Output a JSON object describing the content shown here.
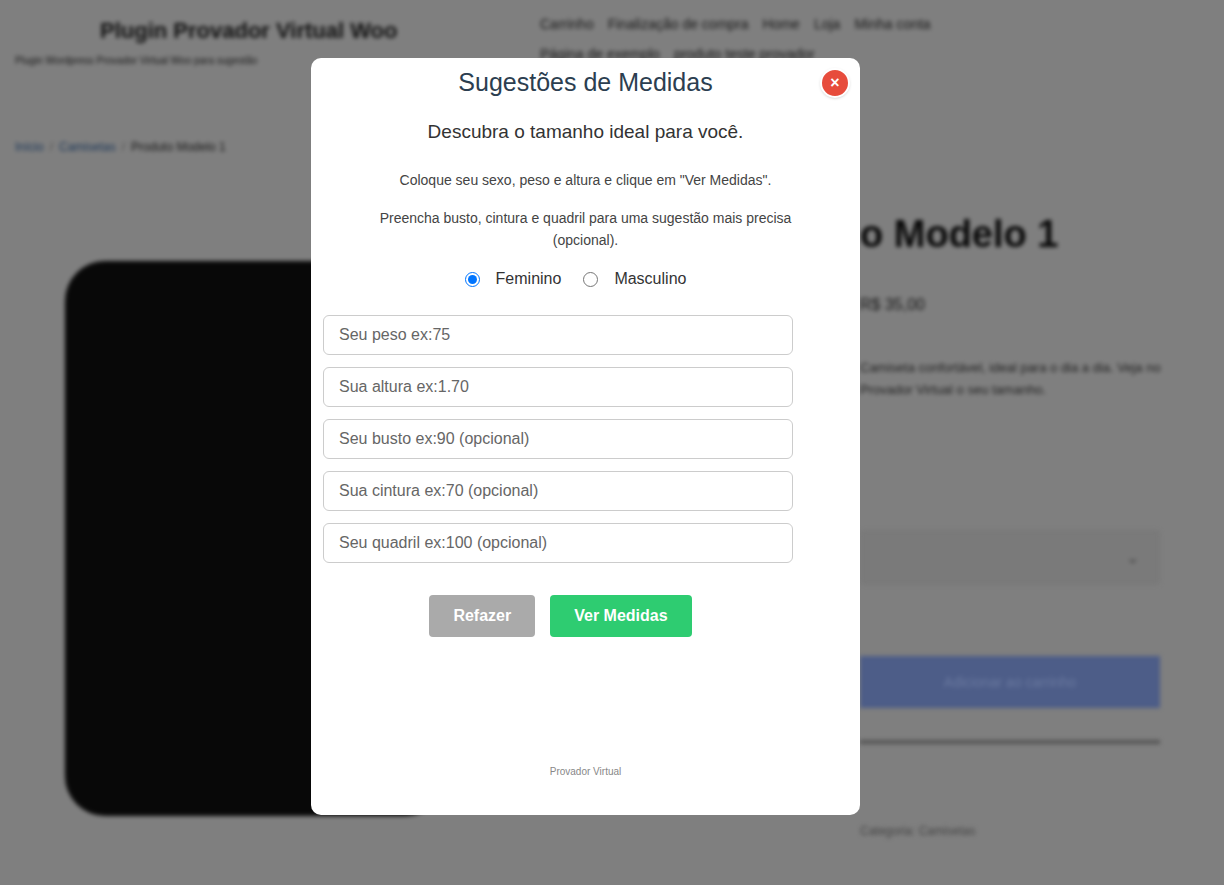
{
  "background": {
    "site_title": "Plugin Provador Virtual Woo",
    "site_tagline": "Plugin Wordpress Provador Virtual Woo para sugestão",
    "nav": [
      "Carrinho",
      "Finalização de compra",
      "Home",
      "Loja",
      "Minha conta",
      "Página de exemplo",
      "produto teste provador"
    ],
    "breadcrumb": [
      "Início",
      "Camisetas",
      "Produto Modelo 1"
    ],
    "breadcrumb_separator": "/",
    "product_title": "o Modelo 1",
    "price": "R$ 35,00",
    "description": [
      "Camiseta confortável, ideal para o dia a dia. Veja no",
      "Provador Virtual o seu tamanho."
    ],
    "select_arrow": "⌄",
    "add_to_cart": "Adicionar ao carrinho",
    "category": "Categoria: Camisetas"
  },
  "modal": {
    "title": "Sugestões de Medidas",
    "close": "×",
    "subtitle": "Descubra o tamanho ideal para você.",
    "instructions": [
      "Coloque seu sexo, peso e altura e clique em \"Ver Medidas\".",
      "Preencha busto, cintura e quadril para uma sugestão mais precisa (opcional)."
    ],
    "genders": [
      {
        "label": "Feminino",
        "selected": true
      },
      {
        "label": "Masculino",
        "selected": false
      }
    ],
    "fields": [
      {
        "placeholder": "Seu peso ex:75",
        "value": ""
      },
      {
        "placeholder": "Sua altura ex:1.70",
        "value": ""
      },
      {
        "placeholder": "Seu busto ex:90 (opcional)",
        "value": ""
      },
      {
        "placeholder": "Sua cintura ex:70 (opcional)",
        "value": ""
      },
      {
        "placeholder": "Seu quadril ex:100 (opcional)",
        "value": ""
      }
    ],
    "buttons": [
      {
        "label": "Refazer",
        "kind": "secondary"
      },
      {
        "label": "Ver Medidas",
        "kind": "primary"
      }
    ],
    "footer": "Provador Virtual"
  }
}
